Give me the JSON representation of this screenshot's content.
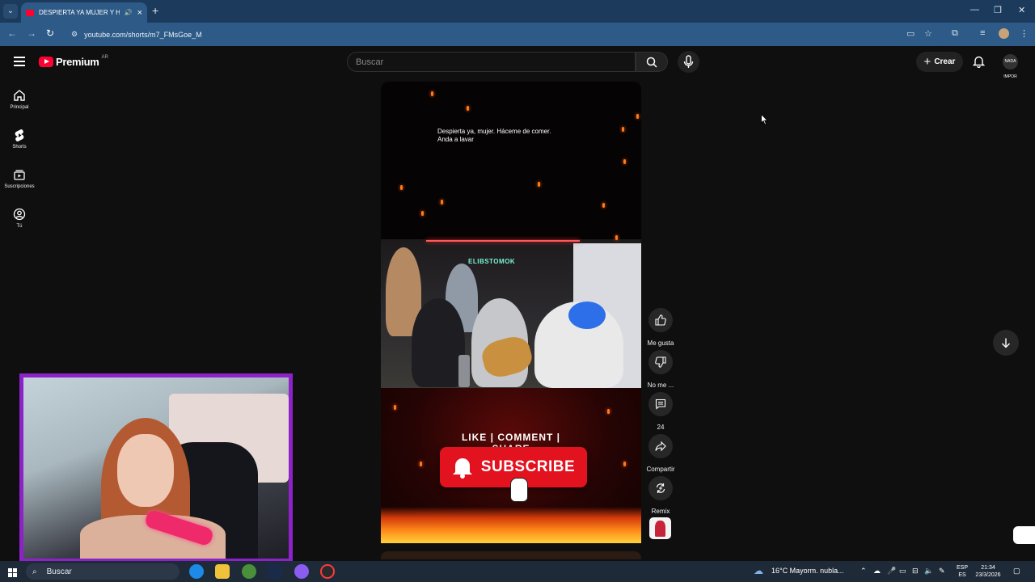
{
  "browser": {
    "tab_title": "DESPIERTA YA MUJER Y HA",
    "url": "youtube.com/shorts/m7_FMsGoe_M"
  },
  "masthead": {
    "brand": "Premium",
    "region": "AR",
    "search_placeholder": "Buscar",
    "create_label": "Crear",
    "account_initials": "NADA IMPOR"
  },
  "guide": [
    {
      "label": "Principal",
      "icon": "home-icon"
    },
    {
      "label": "Shorts",
      "icon": "shorts-icon"
    },
    {
      "label": "Suscripciones",
      "icon": "subscriptions-icon"
    },
    {
      "label": "Tú",
      "icon": "you-icon"
    }
  ],
  "short": {
    "caption_line1": "Despierta ya, mujer. Háceme de comer.",
    "caption_line2": "Anda a lavar",
    "neon_sign": "ELIBSTOMOK",
    "cta_line": "LIKE | COMMENT | SHARE",
    "subscribe_label": "SUBSCRIBE"
  },
  "actions": [
    {
      "label": "Me gusta",
      "icon": "thumbs-up-icon"
    },
    {
      "label": "No me ...",
      "icon": "thumbs-down-icon"
    },
    {
      "label": "24",
      "icon": "comment-icon"
    },
    {
      "label": "Compartir",
      "icon": "share-icon"
    },
    {
      "label": "Remix",
      "icon": "remix-icon"
    }
  ],
  "taskbar": {
    "search_label": "Buscar",
    "weather": "16°C  Mayorm. nubla...",
    "lang_top": "ESP",
    "lang_bottom": "ES",
    "time": "21:34",
    "date": "23/3/2026"
  },
  "colors": {
    "youtube_red": "#ff0033",
    "webcam_border": "#8c22c8",
    "subscribe_red": "#e3121f"
  }
}
